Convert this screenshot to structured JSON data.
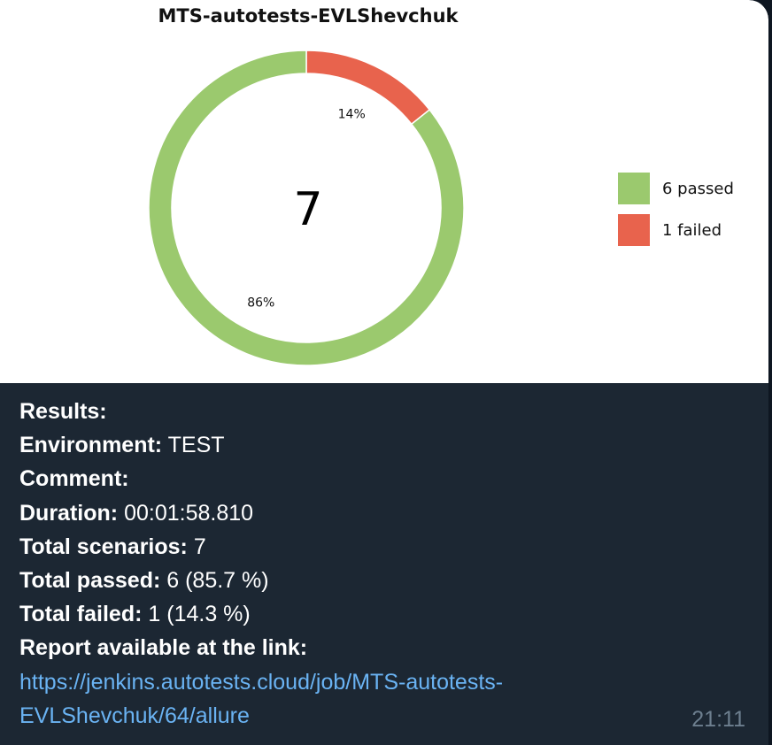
{
  "chart_data": {
    "type": "pie",
    "title": "MTS-autotests-EVLShevchuk",
    "center_label": "7",
    "slices": [
      {
        "label": "6 passed",
        "value": 6,
        "percent_label": "86%",
        "color": "#9bc96e"
      },
      {
        "label": "1 failed",
        "value": 1,
        "percent_label": "14%",
        "color": "#e8634d"
      }
    ]
  },
  "message": {
    "results_label": "Results:",
    "environment_label": "Environment:",
    "environment_value": "TEST",
    "comment_label": "Comment:",
    "duration_label": "Duration:",
    "duration_value": "00:01:58.810",
    "total_scenarios_label": "Total scenarios:",
    "total_scenarios_value": "7",
    "total_passed_label": "Total passed:",
    "total_passed_value": "6 (85.7 %)",
    "total_failed_label": "Total failed:",
    "total_failed_value": "1 (14.3 %)",
    "report_label": "Report available at the link:",
    "link_line1": "https://jenkins.autotests.cloud/job/MTS-autotests-",
    "link_line2": "EVLShevchuk/64/allure",
    "time": "21:11"
  }
}
